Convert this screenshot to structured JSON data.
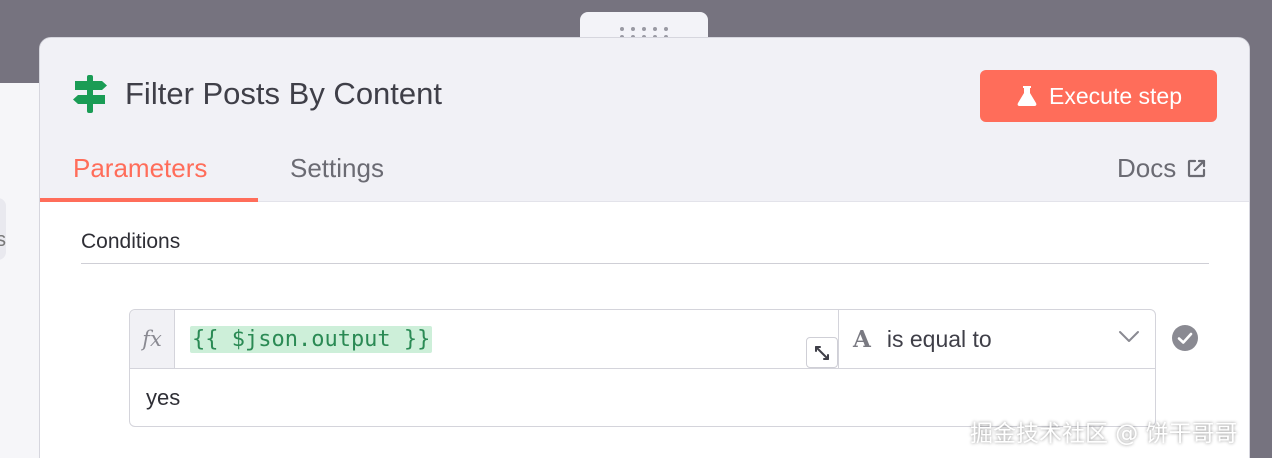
{
  "node": {
    "title": "Filter Posts By Content",
    "icon": "signpost-icon",
    "execute_label": "Execute step"
  },
  "tabs": [
    {
      "label": "Parameters",
      "active": true
    },
    {
      "label": "Settings",
      "active": false
    }
  ],
  "docs_label": "Docs",
  "section": {
    "title": "Conditions"
  },
  "condition": {
    "fx_label": "fx",
    "left_value": "{{ $json.output }}",
    "operator_type_glyph": "A",
    "operator_label": "is equal to",
    "right_value": "yes"
  },
  "colors": {
    "accent": "#ff6d5a",
    "node_icon": "#1a9c55",
    "expression_text": "#2a8a54",
    "expression_bg": "#cdefd9"
  },
  "watermark": "掘金技术社区 @ 饼干哥哥"
}
